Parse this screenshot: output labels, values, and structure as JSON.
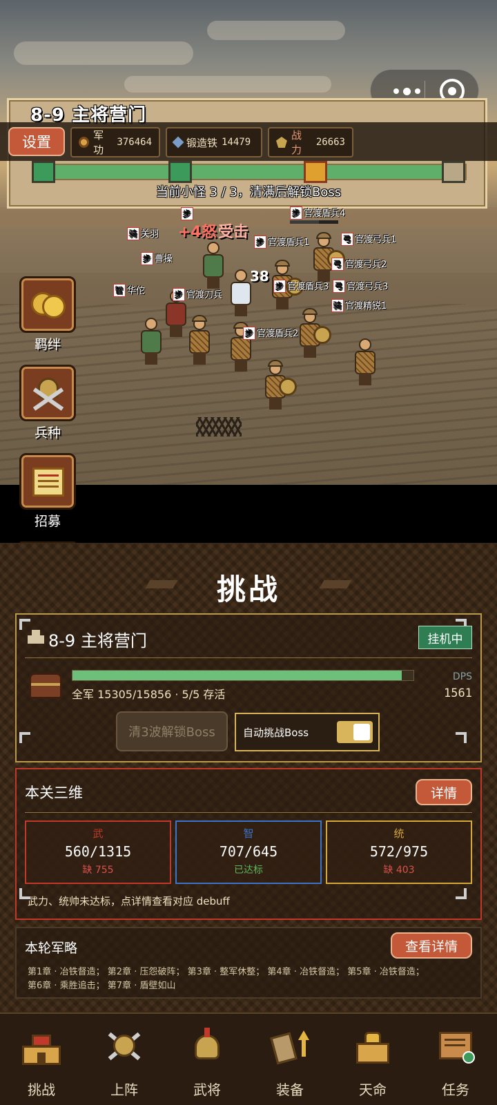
{
  "stage": {
    "title": "8-9 主将营门",
    "wave_status": "当前小怪 3 / 3，清满后解锁Boss",
    "wave_progress": 1.0
  },
  "topbar": {
    "settings_label": "设置",
    "resources": [
      {
        "icon": "military-merit-icon",
        "label": "军功",
        "value": "376464"
      },
      {
        "icon": "forged-iron-icon",
        "label": "锻造铁",
        "value": "14479"
      },
      {
        "icon": "combat-power-icon",
        "label": "战力",
        "value": "26663"
      }
    ]
  },
  "battle": {
    "units": [
      {
        "cls": "步",
        "name": ""
      },
      {
        "cls": "步",
        "name": "官渡盾兵4"
      },
      {
        "cls": "骑",
        "name": "关羽"
      },
      {
        "cls": "步",
        "name": "官渡盾兵1"
      },
      {
        "cls": "弓",
        "name": "官渡弓兵1"
      },
      {
        "cls": "步",
        "name": "曹操"
      },
      {
        "cls": "弓",
        "name": "官渡弓兵2"
      },
      {
        "cls": "智",
        "name": "华佗"
      },
      {
        "cls": "步",
        "name": "官渡刀兵"
      },
      {
        "cls": "步",
        "name": "官渡盾兵3"
      },
      {
        "cls": "弓",
        "name": "官渡弓兵3"
      },
      {
        "cls": "骑",
        "name": "官渡精锐1"
      },
      {
        "cls": "步",
        "name": "官渡盾兵2"
      }
    ],
    "floaters": [
      "+4怒",
      "受击",
      "38"
    ]
  },
  "side_menu": [
    {
      "icon": "bond-coins-icon",
      "label": "羁绊"
    },
    {
      "icon": "troop-type-icon",
      "label": "兵种"
    },
    {
      "icon": "recruit-scroll-icon",
      "label": "招募"
    }
  ],
  "panel": {
    "title": "挑战",
    "stage_card": {
      "title": "8-9 主将营门",
      "afk_badge": "挂机中",
      "army_text": "全军 15305/15856 · 5/5 存活",
      "army_ratio": 0.965,
      "dps_label": "DPS",
      "dps_value": "1561",
      "unlock_boss_label": "清3波解锁Boss",
      "auto_boss_label": "自动挑战Boss",
      "auto_boss_on": true
    },
    "stats_card": {
      "title": "本关三维",
      "detail_label": "详情",
      "stats": [
        {
          "name": "武",
          "value": "560/1315",
          "gap": "缺 755",
          "color": "#c0392b",
          "gap_color": "#d9534f"
        },
        {
          "name": "智",
          "value": "707/645",
          "gap": "已达标",
          "color": "#3b74c9",
          "gap_color": "#5cb85c"
        },
        {
          "name": "统",
          "value": "572/975",
          "gap": "缺 403",
          "color": "#d4a83a",
          "gap_color": "#d9534f"
        }
      ],
      "note": "武力、统帅未达标，点详情查看对应 debuff"
    },
    "strategy_card": {
      "title": "本轮军略",
      "button_label": "查看详情",
      "line1": "第1章 · 冶铁督造； 第2章 · 压怨破阵； 第3章 · 整军休整； 第4章 · 冶铁督造； 第5章 · 冶铁督造；",
      "line2": "第6章 · 乘胜追击； 第7章 · 盾壁如山"
    }
  },
  "bottom_nav": [
    {
      "icon": "castle-icon",
      "label": "挑战"
    },
    {
      "icon": "crossed-swords-shield-icon",
      "label": "上阵"
    },
    {
      "icon": "helmet-icon",
      "label": "武将"
    },
    {
      "icon": "equipment-upgrade-icon",
      "label": "装备"
    },
    {
      "icon": "destiny-box-icon",
      "label": "天命"
    },
    {
      "icon": "quest-board-icon",
      "label": "任务"
    }
  ],
  "colors": {
    "accent_button": "#c4593a",
    "progress_green": "#5fae6a",
    "panel_bg": "#3a2716",
    "afk_green": "#2e7d53"
  }
}
